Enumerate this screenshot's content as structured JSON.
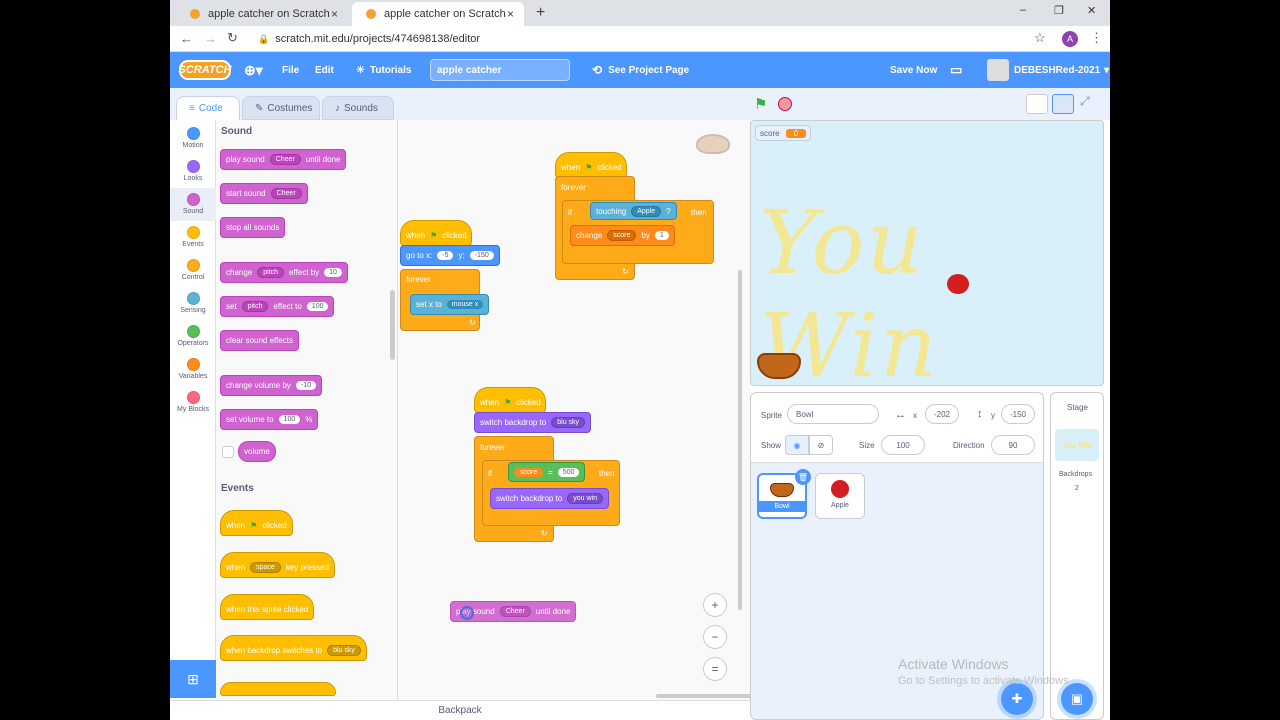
{
  "browser": {
    "tabs": [
      {
        "title": "apple catcher on Scratch",
        "close": "×"
      },
      {
        "title": "apple catcher on Scratch",
        "close": "×"
      }
    ],
    "new_tab": "+",
    "url": "scratch.mit.edu/projects/474698138/editor",
    "profile_initial": "A",
    "window_controls": [
      "–",
      "❐",
      "✕"
    ]
  },
  "menubar": {
    "logo": "SCRATCH",
    "file": "File",
    "edit": "Edit",
    "tutorials": "Tutorials",
    "project_title": "apple catcher",
    "see_project_page": "See Project Page",
    "save_now": "Save Now",
    "username": "DEBESHRed-2021"
  },
  "editor_tabs": {
    "code": "Code",
    "costumes": "Costumes",
    "sounds": "Sounds"
  },
  "categories": [
    {
      "label": "Motion",
      "color": "#4c97ff"
    },
    {
      "label": "Looks",
      "color": "#9966ff"
    },
    {
      "label": "Sound",
      "color": "#cf63cf"
    },
    {
      "label": "Events",
      "color": "#ffbf00"
    },
    {
      "label": "Control",
      "color": "#ffab19"
    },
    {
      "label": "Sensing",
      "color": "#5cb1d6"
    },
    {
      "label": "Operators",
      "color": "#59c059"
    },
    {
      "label": "Variables",
      "color": "#ff8c1a"
    },
    {
      "label": "My Blocks",
      "color": "#ff6680"
    }
  ],
  "palette": {
    "sound_header": "Sound",
    "events_header": "Events",
    "play_sound": "play sound",
    "cheer": "Cheer",
    "until_done": "until done",
    "start_sound": "start sound",
    "stop_all_sounds": "stop all sounds",
    "change": "change",
    "pitch": "pitch",
    "effect_by": "effect by",
    "val10": "10",
    "set": "set",
    "effect_to": "effect to",
    "val100": "100",
    "clear_sound_effects": "clear sound effects",
    "change_volume_by": "change volume by",
    "valm10": "-10",
    "set_volume_to": "set volume to",
    "pct": "%",
    "volume": "volume",
    "when": "when",
    "clicked": "clicked",
    "space": "space",
    "key_pressed": "key pressed",
    "when_sprite_clicked": "when this sprite clicked",
    "when_backdrop_switches": "when backdrop switches to",
    "blu_sky": "blu sky"
  },
  "scripts": {
    "when": "when",
    "clicked": "clicked",
    "forever": "forever",
    "if": "if",
    "then": "then",
    "touching": "touching",
    "apple": "Apple",
    "q": "?",
    "change": "change",
    "score": "score",
    "by": "by",
    "one": "1",
    "go_to_x": "go to x:",
    "x_val": "-5",
    "y": "y:",
    "y_val": "-150",
    "set_x_to": "set x to",
    "mouse_x": "mouse x",
    "switch_backdrop_to": "switch backdrop to",
    "blu_sky": "blu sky",
    "eq": "=",
    "five_hundred": "500",
    "you_win": "you win",
    "play_sound": "play sound",
    "cheer": "Cheer",
    "until_done": "until done"
  },
  "backpack": "Backpack",
  "stage": {
    "monitor_label": "score",
    "monitor_value": "0",
    "backdrop_text": "You Win"
  },
  "sprite_info": {
    "sprite_label": "Sprite",
    "sprite_name": "Bowl",
    "x_label": "x",
    "x_value": "-202",
    "y_label": "y",
    "y_value": "-150",
    "show_label": "Show",
    "size_label": "Size",
    "size_value": "100",
    "direction_label": "Direction",
    "direction_value": "90",
    "sprites": [
      {
        "name": "Bowl"
      },
      {
        "name": "Apple"
      }
    ]
  },
  "stage_panel": {
    "title": "Stage",
    "thumb_text": "You Win",
    "backdrops_label": "Backdrops",
    "backdrops_count": "2"
  },
  "watermark": {
    "line1": "Activate Windows",
    "line2": "Go to Settings to activate Windows."
  }
}
